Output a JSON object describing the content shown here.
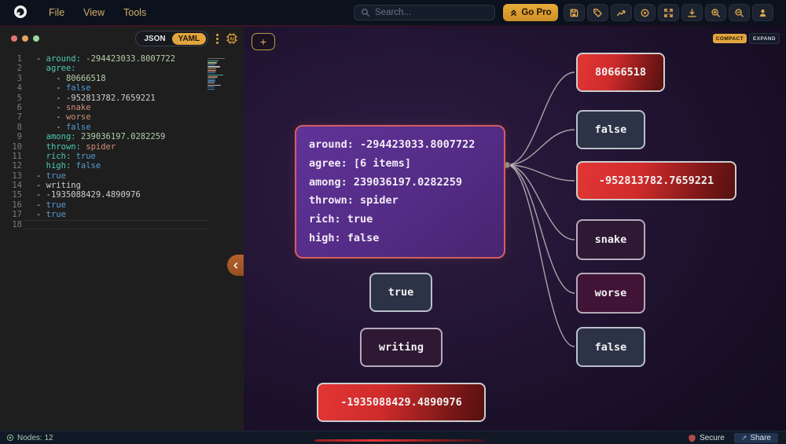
{
  "header": {
    "menus": [
      "File",
      "View",
      "Tools"
    ],
    "search": {
      "placeholder": "Search..."
    },
    "go_pro": "Go Pro",
    "toolbar_icons": [
      "save-icon",
      "tag-icon",
      "trending-up-icon",
      "target-icon",
      "fit-view-icon",
      "download-icon",
      "zoom-in-icon",
      "zoom-out-icon",
      "account-icon"
    ]
  },
  "editor": {
    "format_toggle": {
      "json": "JSON",
      "yaml": "YAML",
      "active": "YAML"
    },
    "lines": [
      {
        "num": "1",
        "tokens": [
          {
            "t": "- ",
            "c": "plain"
          },
          {
            "t": "around:",
            "c": "key"
          },
          {
            "t": " -294423033.8007722",
            "c": "number"
          }
        ]
      },
      {
        "num": "2",
        "tokens": [
          {
            "t": "  ",
            "c": "plain"
          },
          {
            "t": "agree:",
            "c": "key"
          }
        ]
      },
      {
        "num": "3",
        "tokens": [
          {
            "t": "    - ",
            "c": "plain"
          },
          {
            "t": "80666518",
            "c": "number"
          }
        ]
      },
      {
        "num": "4",
        "tokens": [
          {
            "t": "    - ",
            "c": "plain"
          },
          {
            "t": "false",
            "c": "bool"
          }
        ]
      },
      {
        "num": "5",
        "tokens": [
          {
            "t": "    - ",
            "c": "plain"
          },
          {
            "t": "-952813782.7659221",
            "c": "plain"
          }
        ]
      },
      {
        "num": "6",
        "tokens": [
          {
            "t": "    - ",
            "c": "plain"
          },
          {
            "t": "snake",
            "c": "string"
          }
        ]
      },
      {
        "num": "7",
        "tokens": [
          {
            "t": "    - ",
            "c": "plain"
          },
          {
            "t": "worse",
            "c": "string"
          }
        ]
      },
      {
        "num": "8",
        "tokens": [
          {
            "t": "    - ",
            "c": "plain"
          },
          {
            "t": "false",
            "c": "bool"
          }
        ]
      },
      {
        "num": "9",
        "tokens": [
          {
            "t": "  ",
            "c": "plain"
          },
          {
            "t": "among:",
            "c": "key"
          },
          {
            "t": " 239036197.0282259",
            "c": "number"
          }
        ]
      },
      {
        "num": "10",
        "tokens": [
          {
            "t": "  ",
            "c": "plain"
          },
          {
            "t": "thrown:",
            "c": "key"
          },
          {
            "t": " ",
            "c": "plain"
          },
          {
            "t": "spider",
            "c": "string"
          }
        ]
      },
      {
        "num": "11",
        "tokens": [
          {
            "t": "  ",
            "c": "plain"
          },
          {
            "t": "rich:",
            "c": "key"
          },
          {
            "t": " ",
            "c": "plain"
          },
          {
            "t": "true",
            "c": "bool"
          }
        ]
      },
      {
        "num": "12",
        "tokens": [
          {
            "t": "  ",
            "c": "plain"
          },
          {
            "t": "high:",
            "c": "key"
          },
          {
            "t": " ",
            "c": "plain"
          },
          {
            "t": "false",
            "c": "bool"
          }
        ]
      },
      {
        "num": "13",
        "tokens": [
          {
            "t": "- ",
            "c": "plain"
          },
          {
            "t": "true",
            "c": "bool"
          }
        ]
      },
      {
        "num": "14",
        "tokens": [
          {
            "t": "- ",
            "c": "plain"
          },
          {
            "t": "writing",
            "c": "plain"
          }
        ]
      },
      {
        "num": "15",
        "tokens": [
          {
            "t": "- ",
            "c": "plain"
          },
          {
            "t": "-1935088429.4890976",
            "c": "plain"
          }
        ]
      },
      {
        "num": "16",
        "tokens": [
          {
            "t": "- ",
            "c": "plain"
          },
          {
            "t": "true",
            "c": "bool"
          }
        ]
      },
      {
        "num": "17",
        "tokens": [
          {
            "t": "- ",
            "c": "plain"
          },
          {
            "t": "true",
            "c": "bool"
          }
        ]
      },
      {
        "num": "18",
        "tokens": [],
        "active": true
      }
    ]
  },
  "canvas": {
    "add_button": "+",
    "compact_label": "COMPACT",
    "expand_label": "EXPAND",
    "main_node": {
      "rows": [
        "around: -294423033.8007722",
        "agree: [6 items]",
        "among: 239036197.0282259",
        "thrown: spider",
        "rich: true",
        "high: false"
      ]
    },
    "child_nodes": [
      {
        "label": "80666518",
        "variant": "red"
      },
      {
        "label": "false",
        "variant": "slate"
      },
      {
        "label": "-952813782.7659221",
        "variant": "red"
      },
      {
        "label": "snake",
        "variant": "plum"
      },
      {
        "label": "worse",
        "variant": "wine"
      },
      {
        "label": "false",
        "variant": "slate"
      }
    ],
    "root_nodes": [
      {
        "label": "true",
        "variant": "slate"
      },
      {
        "label": "writing",
        "variant": "plum"
      },
      {
        "label": "-1935088429.4890976",
        "variant": "red"
      }
    ]
  },
  "statusbar": {
    "nodes": "Nodes: 12",
    "secure": "Secure",
    "share": "Share"
  },
  "colors": {
    "accent": "#e2a43e",
    "node_red": "#e23636",
    "node_purple": "#542c86",
    "main_border": "#d45e5e",
    "edge": "#bdbdbd",
    "key": "#4ec9b0",
    "number": "#b5cea8",
    "bool": "#569cd6",
    "string": "#ce9178"
  }
}
